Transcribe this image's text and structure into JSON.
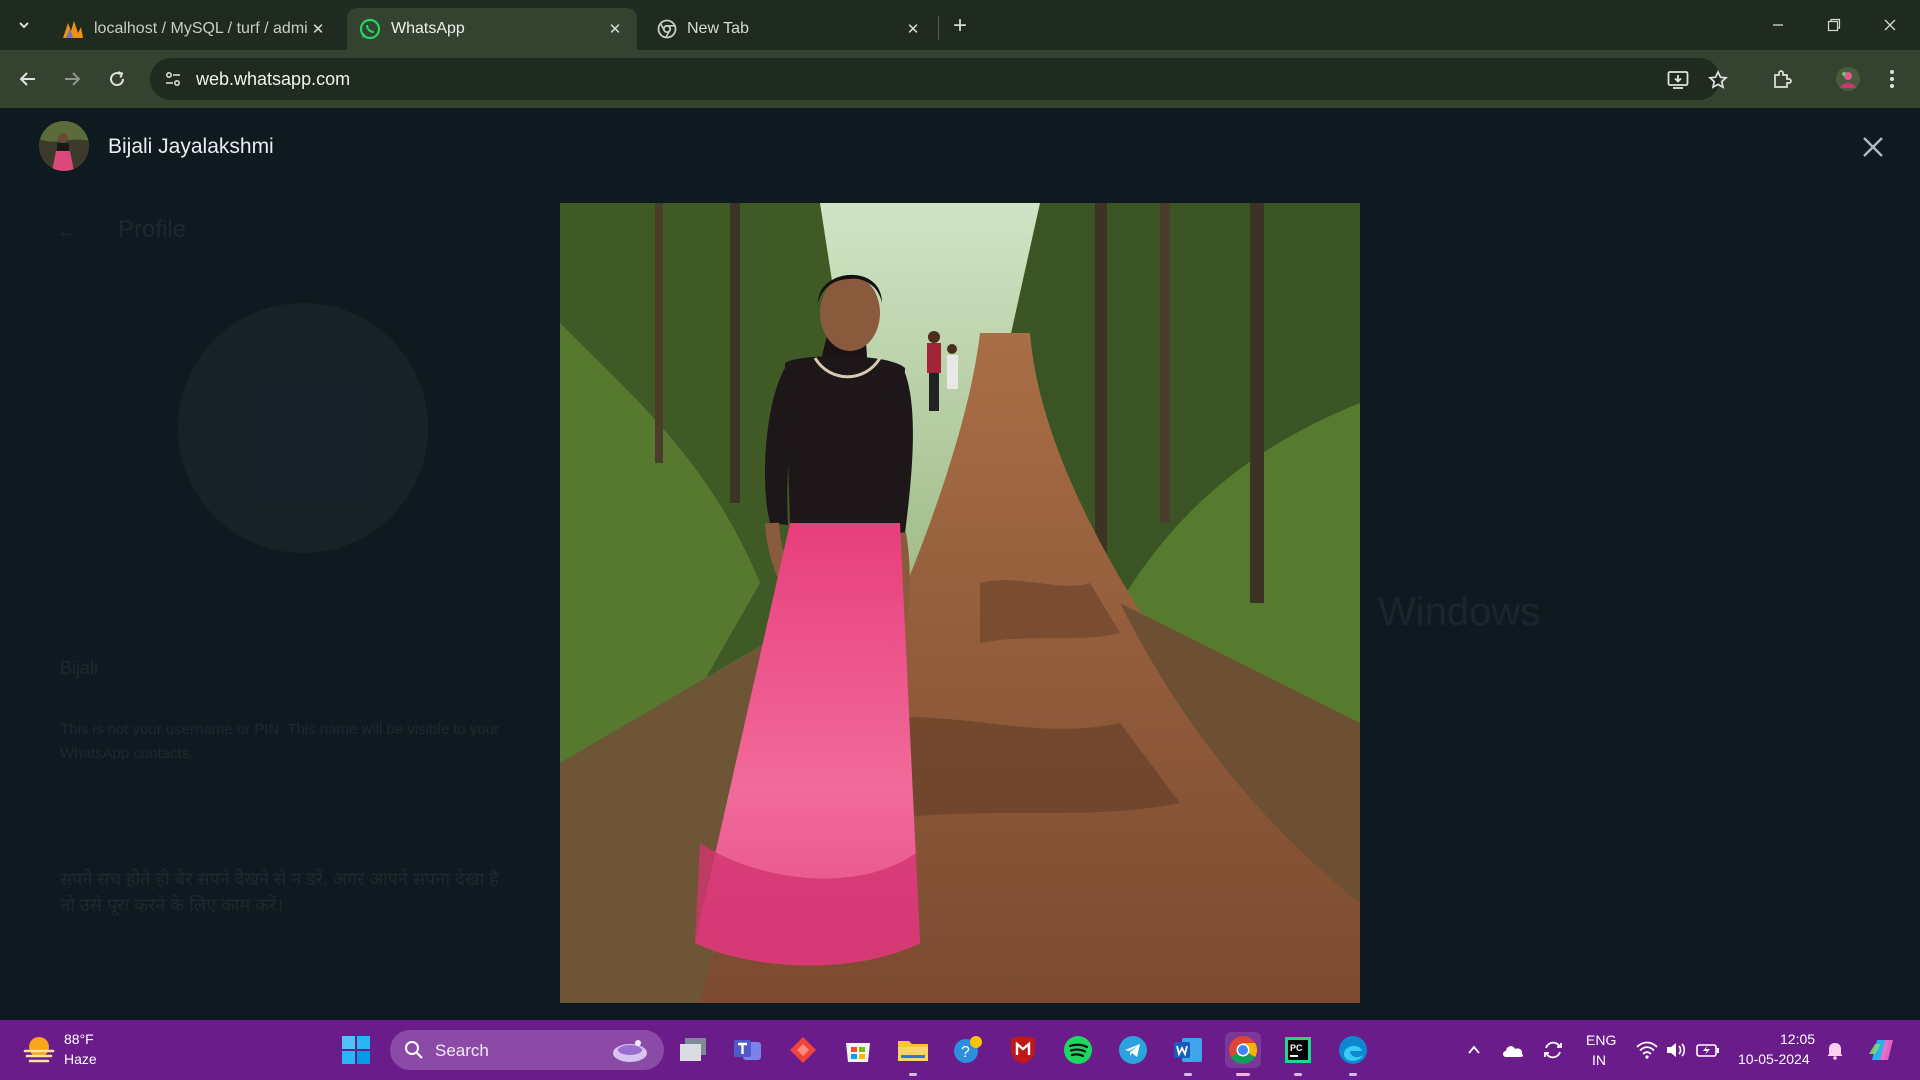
{
  "browser": {
    "tabs": [
      {
        "title": "localhost / MySQL / turf / admin",
        "icon": "phpmyadmin-icon",
        "active": false
      },
      {
        "title": "WhatsApp",
        "icon": "whatsapp-icon",
        "active": true
      },
      {
        "title": "New Tab",
        "icon": "chrome-icon",
        "active": false
      }
    ],
    "url": "web.whatsapp.com"
  },
  "viewer": {
    "contact_name": "Bijali Jayalakshmi",
    "background": {
      "panel_title": "Profile",
      "name_label": "Bijali",
      "name_hint": "This is not your username or PIN. This name will be visible to your WhatsApp contacts.",
      "about_text": "सपने सच होते ही बेर सपने देखने से न डरें, अगर आपने सपना देखा है तो उसे पूरा करने के लिए काम करें।",
      "watermark": "Windows"
    },
    "photo": {
      "subject": "woman in black top and pink skirt on forest dirt path"
    }
  },
  "taskbar": {
    "weather": {
      "temp": "88°F",
      "desc": "Haze"
    },
    "search_label": "Search",
    "language": {
      "line1": "ENG",
      "line2": "IN"
    },
    "clock": {
      "time": "12:05",
      "date": "10-05-2024"
    }
  },
  "colors": {
    "tabstrip": "#1f2b1e",
    "toolbar": "#34432f",
    "viewer_bg": "#0f1a20",
    "taskbar": "#6a1d8a",
    "whatsapp_green": "#25d366"
  }
}
